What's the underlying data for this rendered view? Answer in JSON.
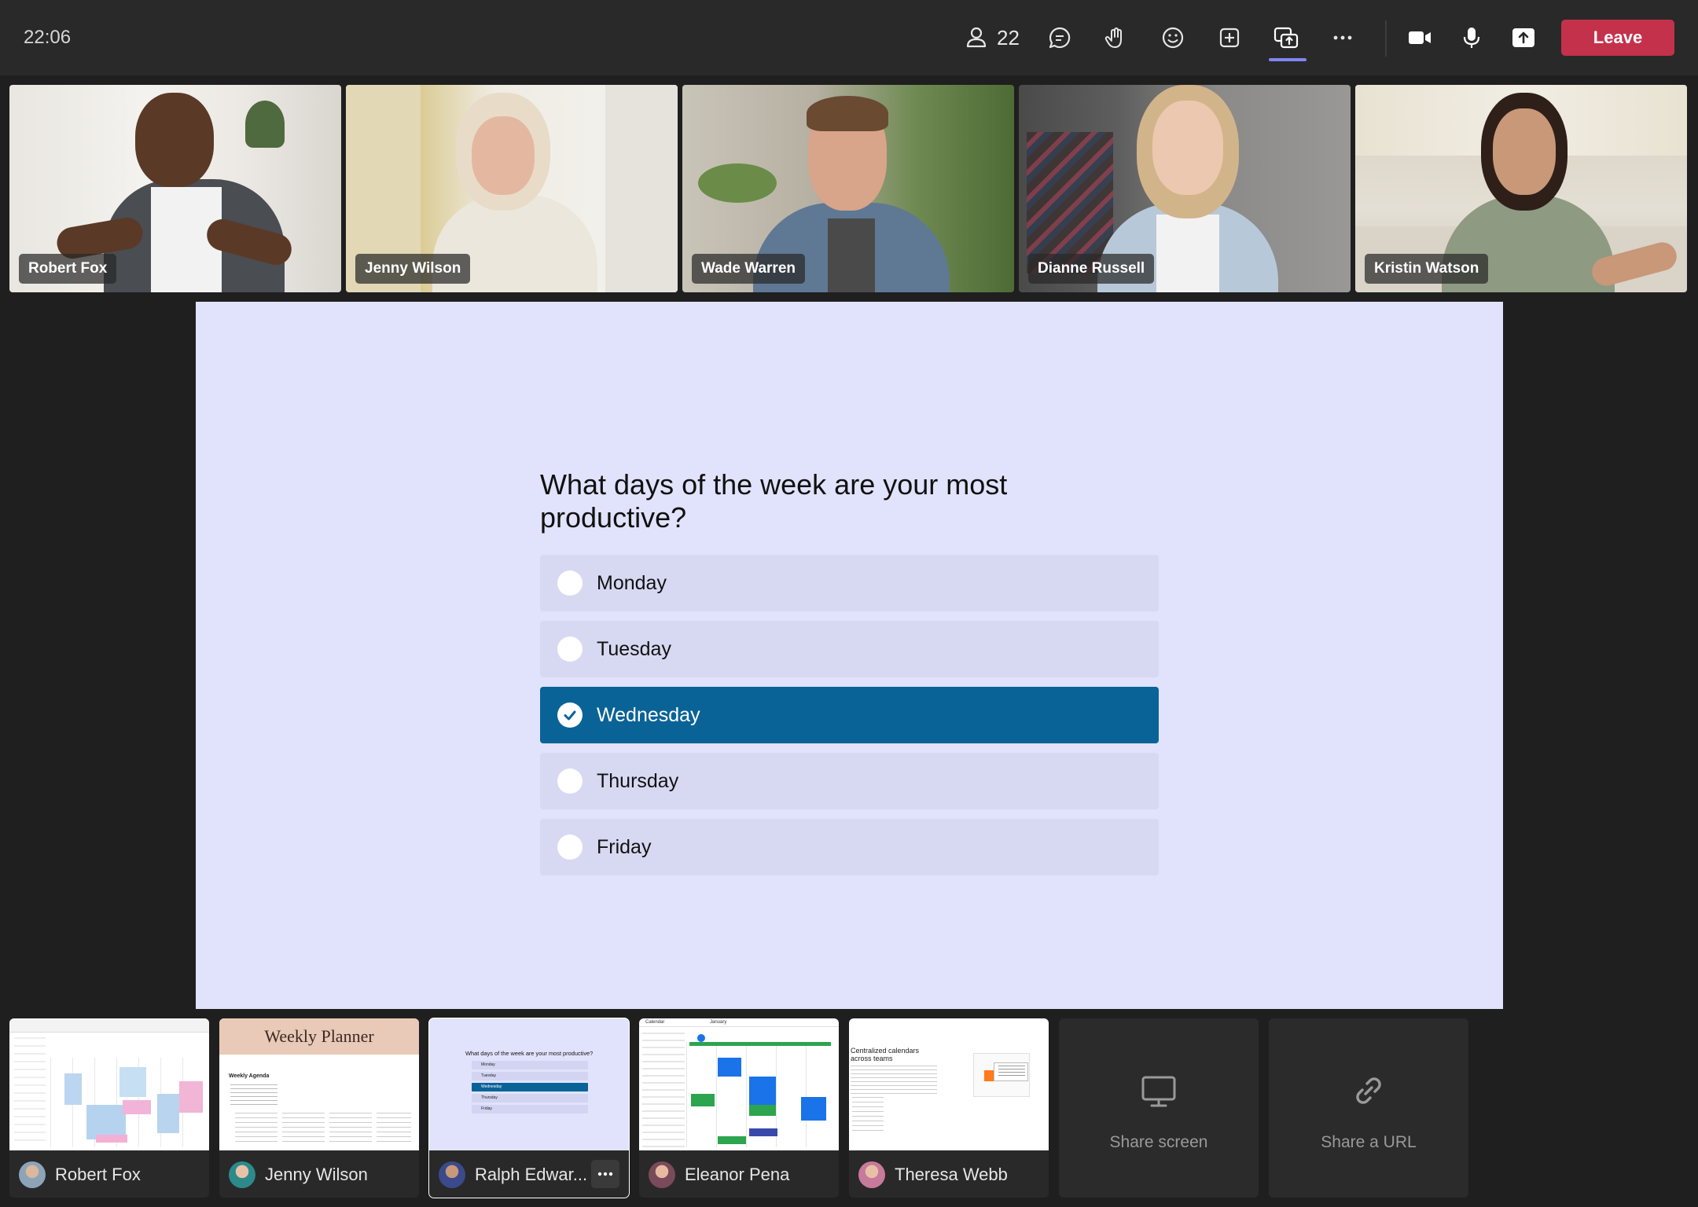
{
  "topbar": {
    "time": "22:06",
    "participants_count": "22",
    "leave_label": "Leave"
  },
  "video_tiles": [
    {
      "name": "Robert Fox"
    },
    {
      "name": "Jenny Wilson"
    },
    {
      "name": "Wade Warren"
    },
    {
      "name": "Dianne Russell"
    },
    {
      "name": "Kristin Watson"
    }
  ],
  "poll": {
    "question": "What days of the week are your most productive?",
    "options": [
      {
        "label": "Monday",
        "selected": false
      },
      {
        "label": "Tuesday",
        "selected": false
      },
      {
        "label": "Wednesday",
        "selected": true
      },
      {
        "label": "Thursday",
        "selected": false
      },
      {
        "label": "Friday",
        "selected": false
      }
    ]
  },
  "share_tray": {
    "cards": [
      {
        "name": "Robert Fox"
      },
      {
        "name": "Jenny Wilson",
        "thumb_title": "Weekly Planner",
        "thumb_sub": "Weekly Agenda"
      },
      {
        "name": "Ralph Edwar...",
        "selected": true,
        "thumb_title": "What days of the week are your most productive?",
        "thumb_options": [
          "Monday",
          "Tuesday",
          "Wednesday",
          "Thursday",
          "Friday"
        ]
      },
      {
        "name": "Eleanor Pena",
        "thumb_title": "Calendar",
        "thumb_sub": "January"
      },
      {
        "name": "Theresa Webb",
        "thumb_title": "Centralized calendars across teams"
      }
    ],
    "share_screen_label": "Share screen",
    "share_url_label": "Share a URL"
  },
  "colors": {
    "accent": "#7f85f5",
    "leave": "#c4314b",
    "poll_selected": "#0a6397",
    "stage_bg": "#e1e3fc"
  }
}
